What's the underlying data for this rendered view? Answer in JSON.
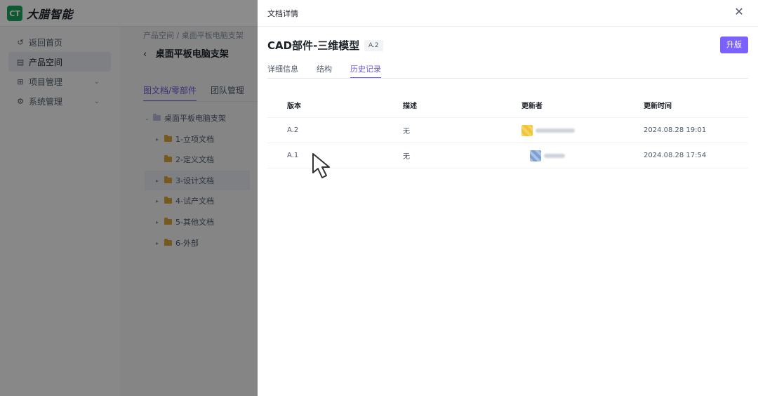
{
  "app": {
    "logo_mark": "CT",
    "logo_text": "大腊智能"
  },
  "sidebar": {
    "items": [
      {
        "label": "返回首页",
        "icon": "return-icon"
      },
      {
        "label": "产品空间",
        "icon": "product-space-icon"
      },
      {
        "label": "项目管理",
        "icon": "grid-icon"
      },
      {
        "label": "系统管理",
        "icon": "gear-icon"
      }
    ]
  },
  "content": {
    "breadcrumb": "产品空间 / 桌面平板电脑支架",
    "title": "桌面平板电脑支架",
    "tabs": [
      "图文档/零部件",
      "团队管理"
    ],
    "tree": [
      {
        "label": "桌面平板电脑支架"
      },
      {
        "label": "1-立项文档"
      },
      {
        "label": "2-定义文档"
      },
      {
        "label": "3-设计文档"
      },
      {
        "label": "4-试产文档"
      },
      {
        "label": "5-其他文档"
      },
      {
        "label": "6-外部"
      }
    ]
  },
  "drawer": {
    "title": "文档详情",
    "doc_title": "CAD部件-三维模型",
    "version_badge": "A.2",
    "upgrade_label": "升版",
    "tabs": [
      "详细信息",
      "结构",
      "历史记录"
    ],
    "active_tab": "历史记录",
    "table": {
      "headers": [
        "版本",
        "描述",
        "更新者",
        "更新时间"
      ],
      "rows": [
        {
          "version": "A.2",
          "description": "无",
          "updater": "",
          "updated_at": "2024.08.28 19:01"
        },
        {
          "version": "A.1",
          "description": "无",
          "updater": "",
          "updated_at": "2024.08.28 17:54"
        }
      ]
    }
  },
  "colors": {
    "accent": "#7b61ff",
    "brand": "#1aa35b",
    "folder": "#d9a33a"
  }
}
